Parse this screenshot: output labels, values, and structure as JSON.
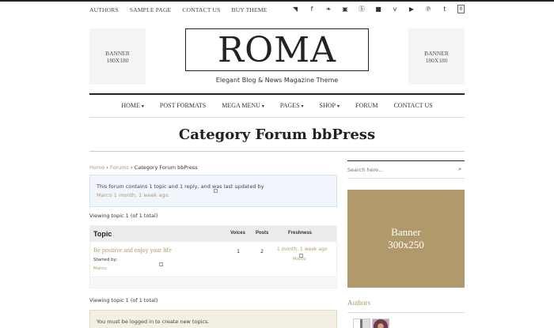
{
  "top_nav": [
    "AUTHORS",
    "SAMPLE PAGE",
    "CONTACT US",
    "BUY THEME"
  ],
  "social_icons": [
    {
      "name": "rss-icon",
      "glyph": "◥"
    },
    {
      "name": "facebook-icon",
      "glyph": "f"
    },
    {
      "name": "twitter-icon",
      "glyph": "❧"
    },
    {
      "name": "instagram-icon",
      "glyph": "▣"
    },
    {
      "name": "skype-icon",
      "glyph": "Ⓢ"
    },
    {
      "name": "flickr-icon",
      "glyph": "■"
    },
    {
      "name": "vimeo-icon",
      "glyph": "v"
    },
    {
      "name": "youtube-icon",
      "glyph": "▶"
    },
    {
      "name": "pinterest-icon",
      "glyph": "℗"
    },
    {
      "name": "tumblr-icon",
      "glyph": "t"
    }
  ],
  "cart_count": "0",
  "banner_left": "BANNER\n180X180",
  "banner_right": "BANNER\n180X180",
  "logo": "ROMA",
  "tagline": "Elegant Blog & News Magazine Theme",
  "main_nav": [
    {
      "label": "HOME",
      "dropdown": true
    },
    {
      "label": "POST FORMATS",
      "dropdown": false
    },
    {
      "label": "MEGA MENU",
      "dropdown": true
    },
    {
      "label": "PAGES",
      "dropdown": true
    },
    {
      "label": "SHOP",
      "dropdown": true
    },
    {
      "label": "FORUM",
      "dropdown": false
    },
    {
      "label": "CONTACT US",
      "dropdown": false
    }
  ],
  "caret": "▾",
  "page_title": "Category Forum bbPress",
  "breadcrumb": {
    "home": "Home",
    "sep": " › ",
    "forums": "Forums",
    "current": "Category Forum bbPress"
  },
  "notice": {
    "text": "This forum contains 1 topic and 1 reply, and was last updated by",
    "author": "Marco",
    "time": "1 month, 1 week ago."
  },
  "viewing_text": "Viewing topic 1 (of 1 total)",
  "table": {
    "headers": {
      "topic": "Topic",
      "voices": "Voices",
      "posts": "Posts",
      "freshness": "Freshness"
    },
    "rows": [
      {
        "title": "Be positive and enjoy your life",
        "started_by": "Started by:",
        "author": "Marco",
        "voices": "1",
        "posts": "2",
        "freshness": "1 month, 1 week ago",
        "fresh_author": "Marco"
      }
    ]
  },
  "login_notice": "You must be logged in to create new topics.",
  "sidebar": {
    "search_placeholder": "Search here...",
    "search_icon": "⌕",
    "ad_banner": "Banner\n300x250",
    "authors_title": "Authors"
  },
  "colors": {
    "accent": "#b09a6b",
    "notice_bg": "#f0f6fb",
    "login_bg": "#f3efe3"
  }
}
